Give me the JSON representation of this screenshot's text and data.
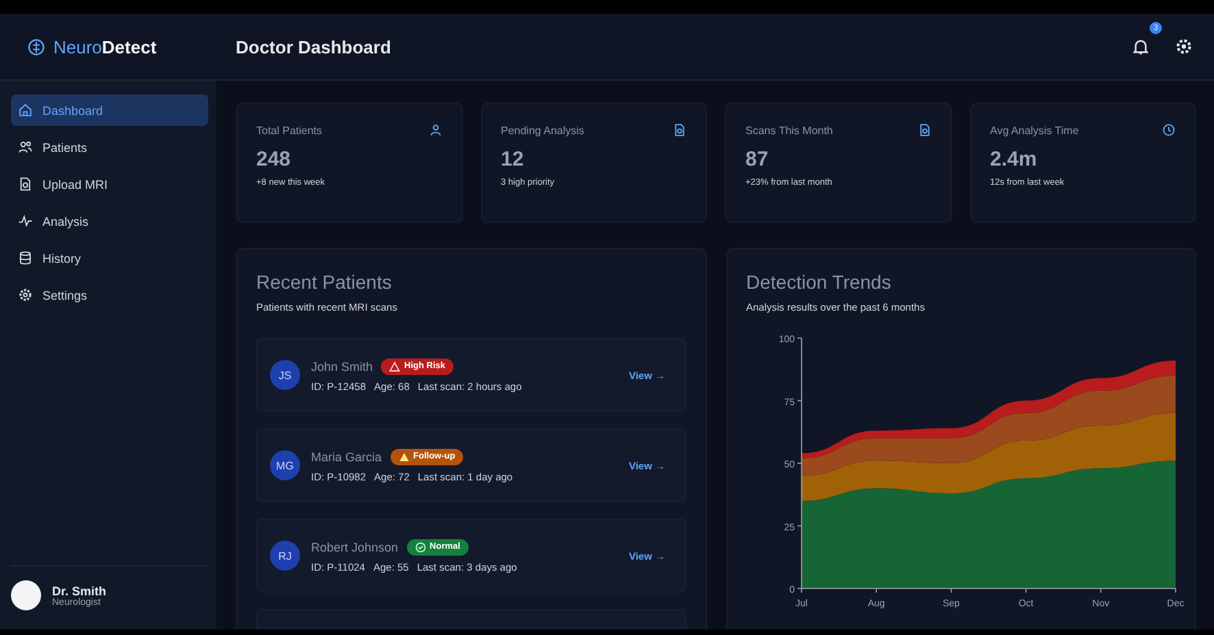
{
  "brand": {
    "first": "Neuro",
    "second": "Detect"
  },
  "header": {
    "title": "Doctor Dashboard",
    "notification_count": "3"
  },
  "sidebar": {
    "items": [
      {
        "label": "Dashboard",
        "selected": true
      },
      {
        "label": "Patients",
        "selected": false
      },
      {
        "label": "Upload MRI",
        "selected": false
      },
      {
        "label": "Analysis",
        "selected": false
      },
      {
        "label": "History",
        "selected": false
      },
      {
        "label": "Settings",
        "selected": false
      }
    ],
    "user": {
      "name": "Dr. Smith",
      "role": "Neurologist"
    }
  },
  "stats": [
    {
      "title": "Total Patients",
      "value": "248",
      "note": "+8 new this week"
    },
    {
      "title": "Pending Analysis",
      "value": "12",
      "note": "3 high priority"
    },
    {
      "title": "Scans This Month",
      "value": "87",
      "note": "+23% from last month"
    },
    {
      "title": "Avg Analysis Time",
      "value": "2.4m",
      "note": "12s from last week"
    }
  ],
  "recent_patients": {
    "title": "Recent Patients",
    "subtitle": "Patients with recent MRI scans",
    "patients": [
      {
        "initials": "JS",
        "name": "John Smith",
        "badge": {
          "label": "High Risk",
          "kind": "high",
          "color": "#b91c1c"
        },
        "id": "ID: P-12458",
        "age": "Age: 68",
        "last_scan": "Last scan: 2 hours ago",
        "action": "View →"
      },
      {
        "initials": "MG",
        "name": "Maria Garcia",
        "badge": {
          "label": "Follow-up",
          "kind": "follow",
          "color": "#b45309"
        },
        "id": "ID: P-10982",
        "age": "Age: 72",
        "last_scan": "Last scan: 1 day ago",
        "action": "View →"
      },
      {
        "initials": "RJ",
        "name": "Robert Johnson",
        "badge": {
          "label": "Normal",
          "kind": "normal",
          "color": "#15803d"
        },
        "id": "ID: P-11024",
        "age": "Age: 55",
        "last_scan": "Last scan: 3 days ago",
        "action": "View →"
      }
    ]
  },
  "detection_trends": {
    "title": "Detection Trends",
    "subtitle": "Analysis results over the past 6 months",
    "chart_data": {
      "type": "area",
      "stacked": true,
      "x": [
        "Jul",
        "Aug",
        "Sep",
        "Oct",
        "Nov",
        "Dec"
      ],
      "ylim": [
        0,
        100
      ],
      "yticks": [
        0,
        25,
        50,
        75,
        100
      ],
      "series": [
        {
          "color": "#166534",
          "values": [
            35,
            40,
            38,
            44,
            48,
            51
          ]
        },
        {
          "color": "#a16207",
          "values": [
            10,
            11,
            12,
            15,
            17,
            19
          ]
        },
        {
          "color": "#9a4a1c",
          "values": [
            7,
            9,
            10,
            11,
            14,
            15
          ]
        },
        {
          "color": "#b91c1c",
          "values": [
            2,
            3,
            4,
            5,
            5,
            6
          ]
        }
      ]
    }
  }
}
